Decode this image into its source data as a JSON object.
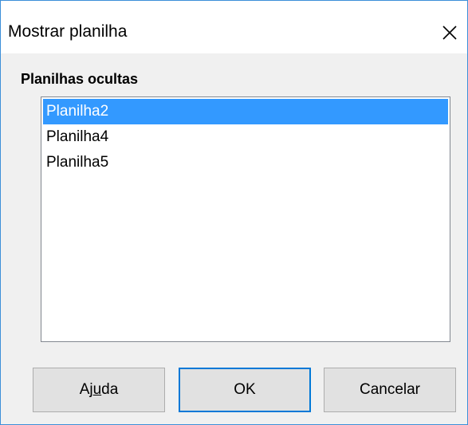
{
  "window": {
    "title": "Mostrar planilha",
    "close_icon": "close-icon"
  },
  "group": {
    "label": "Planilhas ocultas"
  },
  "list": {
    "items": [
      {
        "label": "Planilha2",
        "selected": true
      },
      {
        "label": "Planilha4",
        "selected": false
      },
      {
        "label": "Planilha5",
        "selected": false
      }
    ]
  },
  "buttons": {
    "help": {
      "before": "Aj",
      "accel": "u",
      "after": "da"
    },
    "ok": "OK",
    "cancel": "Cancelar"
  },
  "colors": {
    "selection": "#3399ff",
    "window_border": "#3c8fd9",
    "default_button_border": "#0078d7"
  }
}
